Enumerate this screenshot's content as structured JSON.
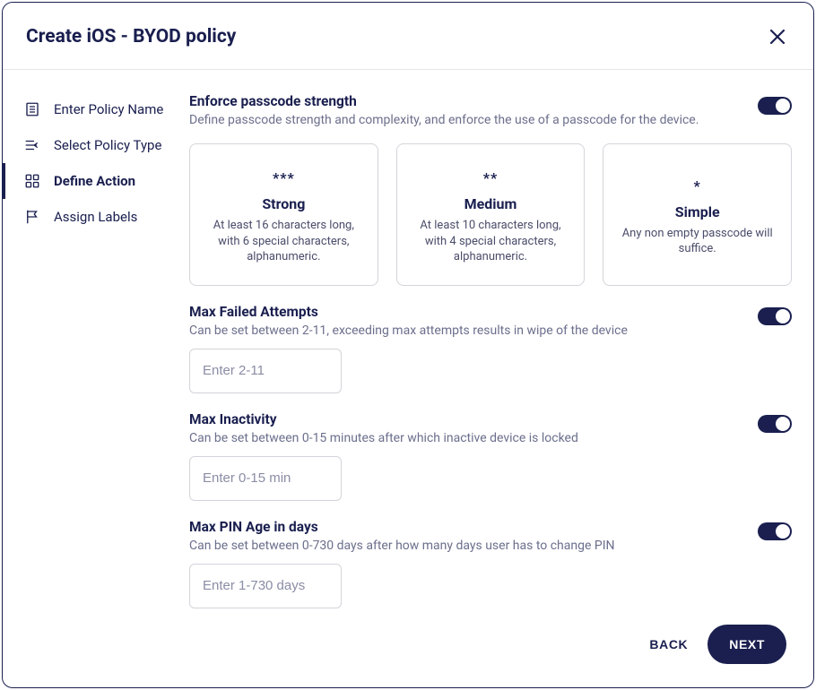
{
  "dialog": {
    "title": "Create iOS - BYOD policy"
  },
  "sidebar": {
    "items": [
      {
        "label": "Enter Policy Name"
      },
      {
        "label": "Select Policy Type"
      },
      {
        "label": "Define Action"
      },
      {
        "label": "Assign Labels"
      }
    ]
  },
  "passcode": {
    "title": "Enforce passcode strength",
    "sub": "Define passcode strength and complexity, and enforce the use of a passcode for the device.",
    "options": [
      {
        "stars": "***",
        "title": "Strong",
        "desc": "At least 16 characters long, with 6 special characters, alphanumeric."
      },
      {
        "stars": "**",
        "title": "Medium",
        "desc": "At least 10 characters long, with 4 special characters, alphanumeric."
      },
      {
        "stars": "*",
        "title": "Simple",
        "desc": "Any non empty passcode will suffice."
      }
    ]
  },
  "maxFailed": {
    "title": "Max Failed Attempts",
    "sub": "Can be set between 2-11, exceeding max attempts results in wipe of the device",
    "placeholder": "Enter 2-11"
  },
  "maxInactivity": {
    "title": "Max Inactivity",
    "sub": "Can be set between 0-15 minutes after which inactive device is locked",
    "placeholder": "Enter 0-15 min"
  },
  "maxPinAge": {
    "title": "Max PIN Age in days",
    "sub": "Can be set between 0-730 days after how many days user has to change PIN",
    "placeholder": "Enter 1-730 days"
  },
  "footer": {
    "back": "BACK",
    "next": "NEXT"
  }
}
